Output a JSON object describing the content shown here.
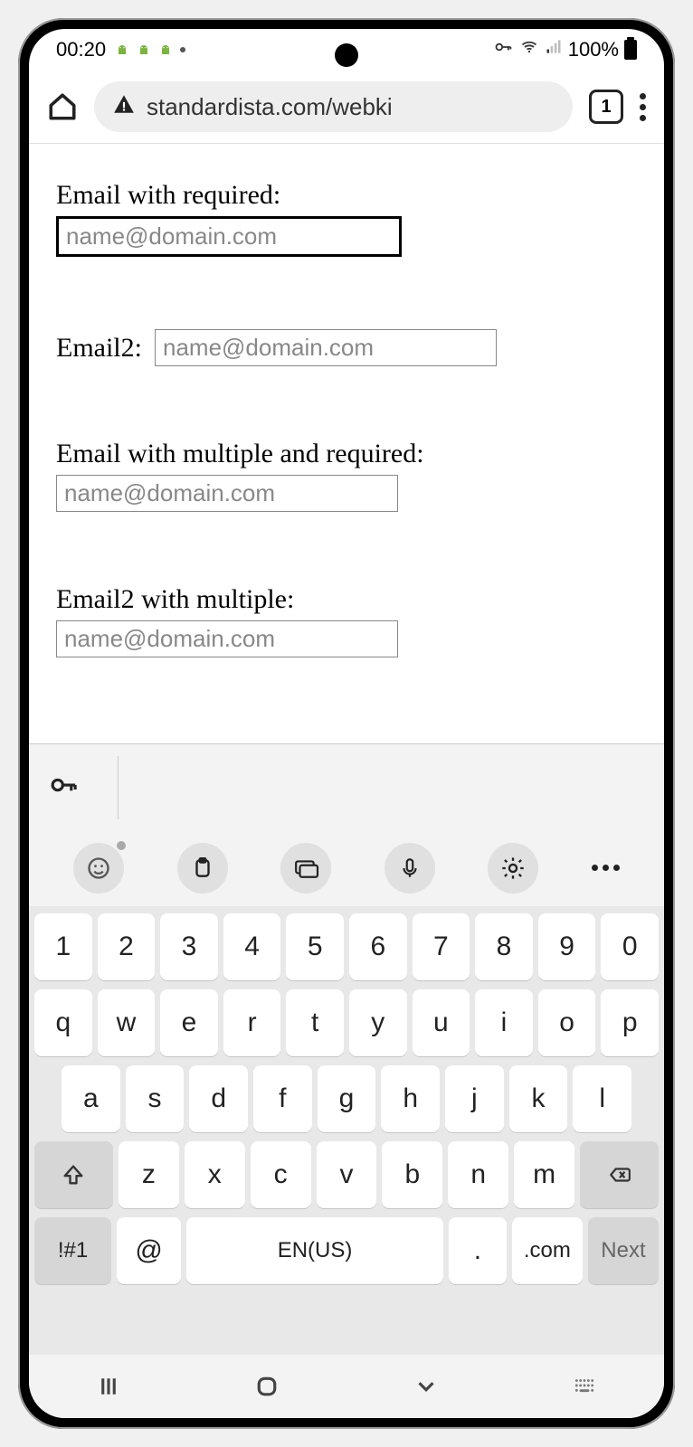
{
  "status": {
    "time": "00:20",
    "battery": "100%"
  },
  "browser": {
    "url": "standardista.com/webki",
    "tab_count": "1"
  },
  "form": {
    "field1_label": "Email with required:",
    "field1_placeholder": "name@domain.com",
    "field2_label": "Email2:",
    "field2_placeholder": "name@domain.com",
    "field3_label": "Email with multiple and required:",
    "field3_placeholder": "name@domain.com",
    "field4_label": "Email2 with multiple:",
    "field4_placeholder": "name@domain.com"
  },
  "keyboard": {
    "row1": [
      "1",
      "2",
      "3",
      "4",
      "5",
      "6",
      "7",
      "8",
      "9",
      "0"
    ],
    "row2": [
      "q",
      "w",
      "e",
      "r",
      "t",
      "y",
      "u",
      "i",
      "o",
      "p"
    ],
    "row3": [
      "a",
      "s",
      "d",
      "f",
      "g",
      "h",
      "j",
      "k",
      "l"
    ],
    "row4": [
      "z",
      "x",
      "c",
      "v",
      "b",
      "n",
      "m"
    ],
    "sym": "!#1",
    "at": "@",
    "space": "EN(US)",
    "period": ".",
    "dotcom": ".com",
    "next": "Next"
  }
}
